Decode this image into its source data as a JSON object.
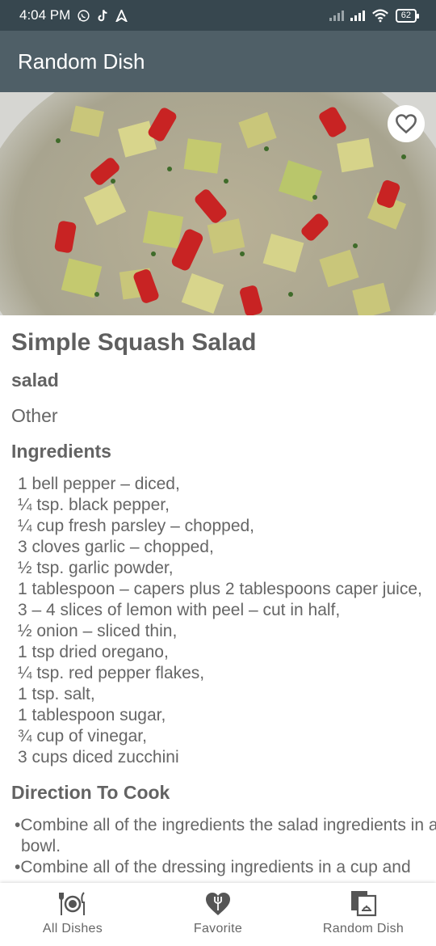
{
  "status_bar": {
    "time": "4:04 PM",
    "battery": "62"
  },
  "app_bar": {
    "title": "Random Dish"
  },
  "dish": {
    "name": "Simple Squash Salad",
    "type": "salad",
    "category": "Other",
    "favorite": false
  },
  "ingredients": {
    "title": "Ingredients",
    "items": [
      "1 bell pepper – diced,",
      "¼ tsp. black pepper,",
      "¼ cup fresh parsley – chopped,",
      "3 cloves garlic – chopped,",
      "½ tsp. garlic powder,",
      "1 tablespoon – capers plus 2 tablespoons caper juice,",
      "3 – 4 slices of lemon with peel – cut in half,",
      "½ onion – sliced thin,",
      "1 tsp dried oregano,",
      "¼ tsp. red pepper flakes,",
      "1 tsp. salt,",
      "1 tablespoon sugar,",
      "¾ cup of vinegar,",
      "3 cups diced zucchini"
    ]
  },
  "directions": {
    "title": "Direction To Cook",
    "steps": [
      "•Combine all of the ingredients the salad ingredients in a bowl.",
      "•Combine all of the dressing ingredients in a cup and"
    ]
  },
  "bottom_nav": {
    "items": [
      {
        "label": "All Dishes",
        "icon": "plate-cutlery-icon"
      },
      {
        "label": "Favorite",
        "icon": "heart-fork-icon"
      },
      {
        "label": "Random Dish",
        "icon": "random-dish-icon"
      }
    ],
    "active_index": 2
  },
  "colors": {
    "status_bar": "#37474f",
    "app_bar": "#4f5f67",
    "text": "#636363"
  }
}
